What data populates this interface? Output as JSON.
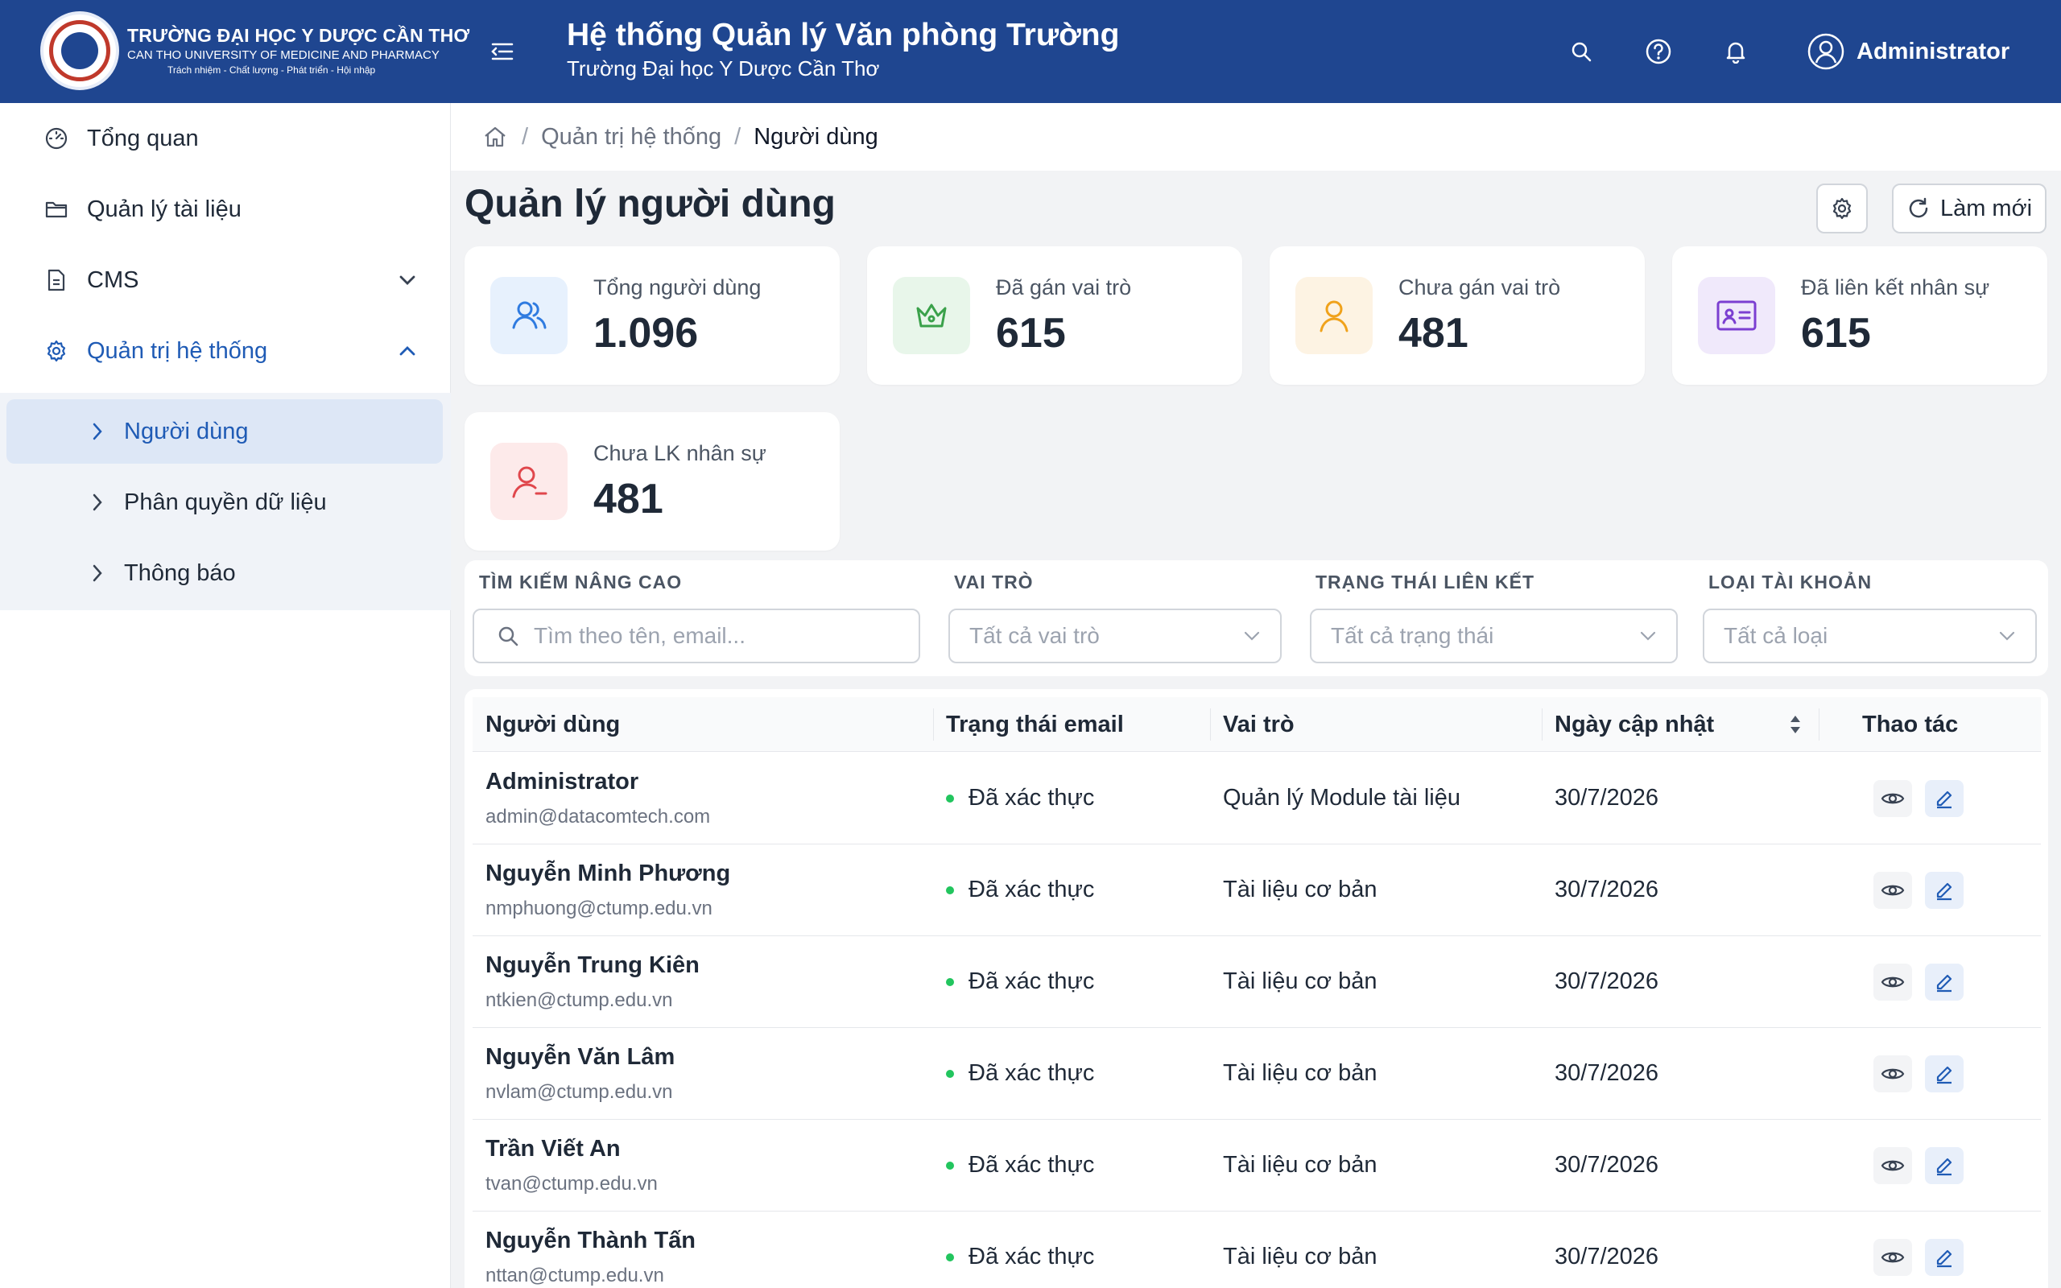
{
  "header": {
    "logo_line1": "TRƯỜNG ĐẠI HỌC Y DƯỢC CẦN THƠ",
    "logo_line2": "CAN THO UNIVERSITY OF MEDICINE AND PHARMACY",
    "logo_line3": "Trách nhiệm - Chất lượng - Phát triển - Hội nhập",
    "title": "Hệ thống Quản lý Văn phòng Trường",
    "subtitle": "Trường Đại học Y Dược Cần Thơ",
    "user": "Administrator",
    "icons": [
      "menu-icon",
      "search-icon",
      "help-icon",
      "bell-icon",
      "user-icon"
    ]
  },
  "sidebar": {
    "items": [
      {
        "label": "Tổng quan",
        "icon": "dashboard-icon"
      },
      {
        "label": "Quản lý tài liệu",
        "icon": "folder-icon"
      },
      {
        "label": "CMS",
        "icon": "document-icon"
      },
      {
        "label": "Quản trị hệ thống",
        "icon": "gear-icon"
      }
    ],
    "subitems": [
      {
        "label": "Người dùng",
        "active": true
      },
      {
        "label": "Phân quyền dữ liệu"
      },
      {
        "label": "Thông báo"
      }
    ]
  },
  "breadcrumb": {
    "parent": "Quản trị hệ thống",
    "current": "Người dùng"
  },
  "page": {
    "title": "Quản lý người dùng",
    "refresh_label": "Làm mới"
  },
  "stats": [
    {
      "label": "Tổng người dùng",
      "value": "1.096",
      "icon": "users-icon",
      "color": "#2f7be0",
      "bg": "#e7f1fd"
    },
    {
      "label": "Đã gán vai trò",
      "value": "615",
      "icon": "crown-icon",
      "color": "#3aa14a",
      "bg": "#e8f6ea"
    },
    {
      "label": "Chưa gán vai trò",
      "value": "481",
      "icon": "user-icon",
      "color": "#f0a21b",
      "bg": "#fdf3e3"
    },
    {
      "label": "Đã liên kết nhân sự",
      "value": "615",
      "icon": "id-card-icon",
      "color": "#7b3fd1",
      "bg": "#f0e9fb"
    },
    {
      "label": "Chưa LK nhân sự",
      "value": "481",
      "icon": "user-minus-icon",
      "color": "#e0474c",
      "bg": "#fdeaea"
    }
  ],
  "filters": {
    "search_label": "TÌM KIẾM NÂNG CAO",
    "search_placeholder": "Tìm theo tên, email...",
    "role_label": "VAI TRÒ",
    "role_value": "Tất cả vai trò",
    "link_label": "TRẠNG THÁI LIÊN KẾT",
    "link_value": "Tất cả trạng thái",
    "type_label": "LOẠI TÀI KHOẢN",
    "type_value": "Tất cả loại"
  },
  "table": {
    "headers": [
      "Người dùng",
      "Trạng thái email",
      "Vai trò",
      "Ngày cập nhật",
      "Thao tác"
    ],
    "rows": [
      {
        "name": "Administrator",
        "email": "admin@datacomtech.com",
        "status": "Đã xác thực",
        "role": "Quản lý Module tài liệu",
        "date": "30/7/2026"
      },
      {
        "name": "Nguyễn Minh Phương",
        "email": "nmphuong@ctump.edu.vn",
        "status": "Đã xác thực",
        "role": "Tài liệu cơ bản",
        "date": "30/7/2026"
      },
      {
        "name": "Nguyễn Trung Kiên",
        "email": "ntkien@ctump.edu.vn",
        "status": "Đã xác thực",
        "role": "Tài liệu cơ bản",
        "date": "30/7/2026"
      },
      {
        "name": "Nguyễn Văn Lâm",
        "email": "nvlam@ctump.edu.vn",
        "status": "Đã xác thực",
        "role": "Tài liệu cơ bản",
        "date": "30/7/2026"
      },
      {
        "name": "Trần Viết An",
        "email": "tvan@ctump.edu.vn",
        "status": "Đã xác thực",
        "role": "Tài liệu cơ bản",
        "date": "30/7/2026"
      },
      {
        "name": "Nguyễn Thành Tấn",
        "email": "nttan@ctump.edu.vn",
        "status": "Đã xác thực",
        "role": "Tài liệu cơ bản",
        "date": "30/7/2026"
      }
    ]
  }
}
